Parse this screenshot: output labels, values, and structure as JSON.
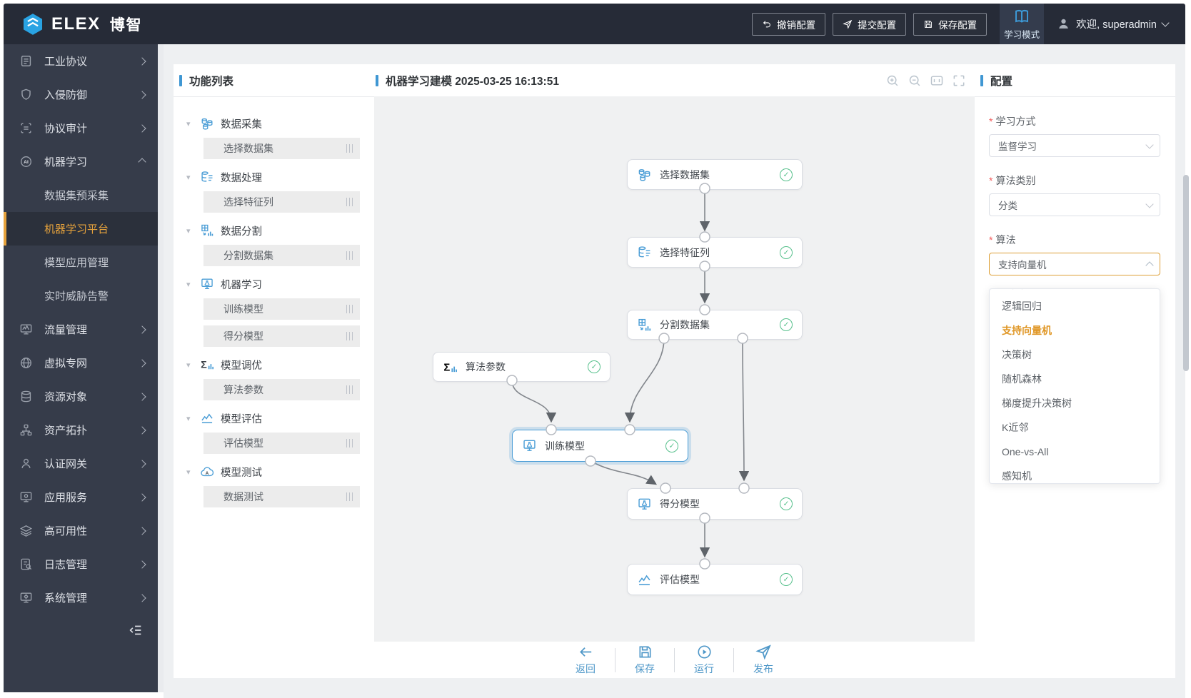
{
  "topbar": {
    "logo_text": "ELEX",
    "logo_cn": "博智",
    "buttons": [
      {
        "label": "撤销配置",
        "icon": "undo-icon"
      },
      {
        "label": "提交配置",
        "icon": "submit-icon"
      },
      {
        "label": "保存配置",
        "icon": "save-icon"
      }
    ],
    "mode": {
      "label": "学习模式",
      "icon": "book-icon"
    },
    "user": {
      "greeting": "欢迎, superadmin"
    }
  },
  "sidebar": {
    "items": [
      {
        "label": "工业协议"
      },
      {
        "label": "入侵防御"
      },
      {
        "label": "协议审计"
      },
      {
        "label": "机器学习",
        "expanded": true,
        "children": [
          {
            "label": "数据集预采集"
          },
          {
            "label": "机器学习平台",
            "active": true
          },
          {
            "label": "模型应用管理"
          },
          {
            "label": "实时威胁告警"
          }
        ]
      },
      {
        "label": "流量管理"
      },
      {
        "label": "虚拟专网"
      },
      {
        "label": "资源对象"
      },
      {
        "label": "资产拓扑"
      },
      {
        "label": "认证网关"
      },
      {
        "label": "应用服务"
      },
      {
        "label": "高可用性"
      },
      {
        "label": "日志管理"
      },
      {
        "label": "系统管理"
      }
    ]
  },
  "function_panel": {
    "title": "功能列表",
    "groups": [
      {
        "label": "数据采集",
        "children": [
          "选择数据集"
        ]
      },
      {
        "label": "数据处理",
        "children": [
          "选择特征列"
        ]
      },
      {
        "label": "数据分割",
        "children": [
          "分割数据集"
        ]
      },
      {
        "label": "机器学习",
        "children": [
          "训练模型",
          "得分模型"
        ]
      },
      {
        "label": "模型调优",
        "children": [
          "算法参数"
        ]
      },
      {
        "label": "模型评估",
        "children": [
          "评估模型"
        ]
      },
      {
        "label": "模型测试",
        "children": [
          "数据测试"
        ]
      }
    ]
  },
  "canvas": {
    "title": "机器学习建模 2025-03-25 16:13:51",
    "tools": [
      "zoom-in-icon",
      "zoom-out-icon",
      "actual-size-icon",
      "fullscreen-icon"
    ],
    "nodes": [
      {
        "label": "选择数据集",
        "status": "success"
      },
      {
        "label": "选择特征列",
        "status": "success"
      },
      {
        "label": "分割数据集",
        "status": "success"
      },
      {
        "label": "算法参数",
        "status": "success"
      },
      {
        "label": "训练模型",
        "status": "success",
        "selected": true
      },
      {
        "label": "得分模型",
        "status": "success"
      },
      {
        "label": "评估模型",
        "status": "success"
      }
    ],
    "check_glyph": "✓",
    "footer": [
      {
        "label": "返回",
        "icon": "back-icon"
      },
      {
        "label": "保存",
        "icon": "save-icon"
      },
      {
        "label": "运行",
        "icon": "run-icon"
      },
      {
        "label": "发布",
        "icon": "publish-icon"
      }
    ]
  },
  "config_panel": {
    "title": "配置",
    "fields": [
      {
        "label": "学习方式",
        "value": "监督学习",
        "required": true,
        "state": "closed"
      },
      {
        "label": "算法类别",
        "value": "分类",
        "required": true,
        "state": "closed"
      },
      {
        "label": "算法",
        "value": "支持向量机",
        "required": true,
        "state": "open"
      }
    ],
    "dropdown_options": [
      "逻辑回归",
      "支持向量机",
      "决策树",
      "随机森林",
      "梯度提升决策树",
      "K近邻",
      "One-vs-All",
      "感知机"
    ],
    "selected_option": "支持向量机"
  },
  "colors": {
    "topbar_bg": "#262b37",
    "sidebar_bg": "#363c4a",
    "accent_blue": "#3f97d3",
    "accent_orange": "#e6a23c",
    "node_check_green": "#57c08c",
    "selected_node_border": "#4a9dd6",
    "focused_select_border": "#dd9f36"
  },
  "tree_caret_glyph": "▾"
}
